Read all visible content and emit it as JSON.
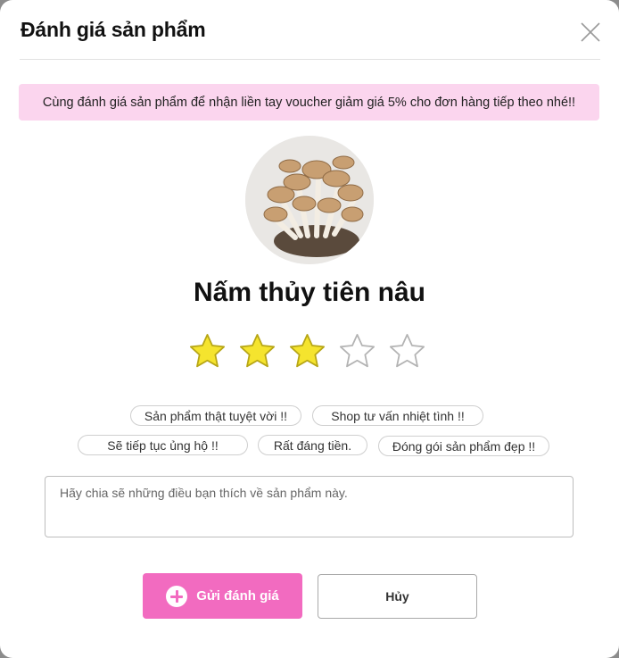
{
  "modal": {
    "title": "Đánh giá sản phẩm",
    "close_icon": "close-icon"
  },
  "banner": {
    "text": "Cùng đánh giá sản phẩm để nhận liền tay voucher giảm giá 5% cho đơn hàng tiếp theo nhé!!"
  },
  "product": {
    "name": "Nấm thủy tiên nâu",
    "image_icon": "mushroom-image"
  },
  "rating": {
    "value": 3,
    "max": 5,
    "filled_color": "#f5e42e",
    "empty_color": "#ffffff"
  },
  "quick_tags": [
    "Sản phẩm thật tuyệt vời !!",
    "Shop tư vấn nhiệt tình !!",
    "Sẽ tiếp tục ủng hộ !!",
    "Rất đáng tiền.",
    "Đóng gói sản phẩm đẹp !!"
  ],
  "review": {
    "placeholder": "Hãy chia sẽ những điều bạn thích về sản phẩm này.",
    "value": ""
  },
  "actions": {
    "submit_label": "Gửi đánh giá",
    "submit_icon": "plus-circle-icon",
    "cancel_label": "Hủy"
  },
  "colors": {
    "accent": "#f26bc0",
    "banner_bg": "#fbd5ee"
  }
}
